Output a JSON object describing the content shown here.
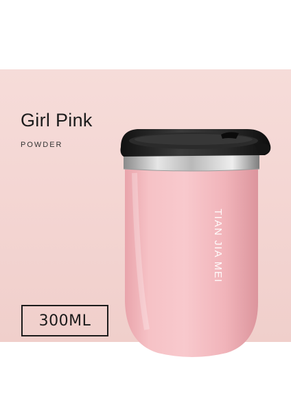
{
  "product": {
    "color_name": "Girl Pink",
    "color_family": "POWDER",
    "capacity_label": "300ML",
    "brand_text": "TIAN JIA MEI"
  },
  "colors": {
    "background_band": "#f4d6d3",
    "cup_body": "#f4b8bd",
    "lid": "#1e1e1e",
    "rim": "#c9c9c9",
    "text": "#1c1c1c"
  }
}
